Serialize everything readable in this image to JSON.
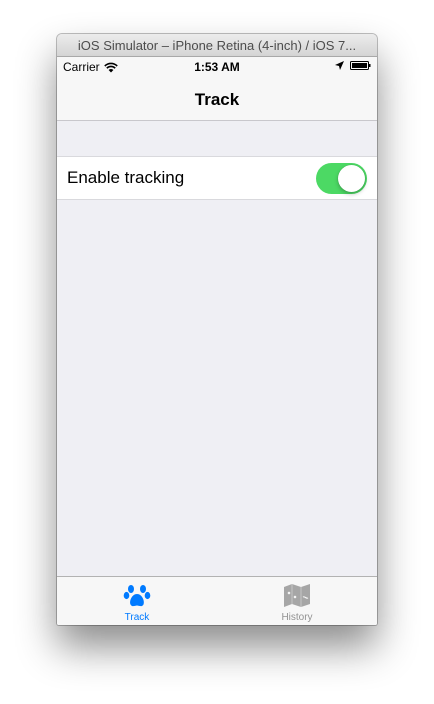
{
  "window": {
    "title": "iOS Simulator – iPhone Retina (4-inch) / iOS 7..."
  },
  "statusbar": {
    "carrier": "Carrier",
    "time": "1:53 AM",
    "icons": [
      "wifi-icon",
      "location-arrow-icon",
      "battery-icon"
    ]
  },
  "navbar": {
    "title": "Track"
  },
  "settings": {
    "rows": [
      {
        "label": "Enable tracking",
        "toggle_on": true
      }
    ]
  },
  "tabbar": {
    "tabs": [
      {
        "label": "Track",
        "icon": "paw-icon",
        "active": true
      },
      {
        "label": "History",
        "icon": "map-icon",
        "active": false
      }
    ]
  },
  "colors": {
    "accent": "#007aff",
    "toggle_on": "#4cd964",
    "background": "#efeff4",
    "bar": "#f7f7f7"
  }
}
